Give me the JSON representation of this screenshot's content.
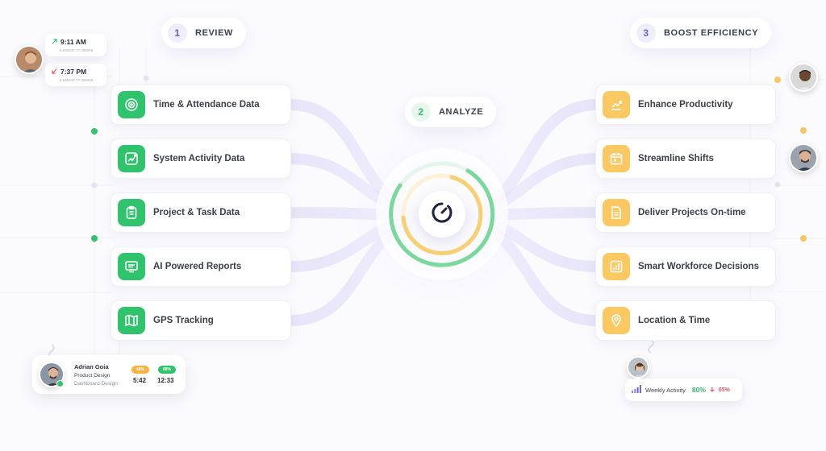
{
  "steps": [
    {
      "number": "1",
      "label": "REVIEW"
    },
    {
      "number": "2",
      "label": "ANALYZE"
    },
    {
      "number": "3",
      "label": "BOOST EFFICIENCY"
    }
  ],
  "data_sources": [
    {
      "label": "Time & Attendance Data",
      "icon": "target-icon"
    },
    {
      "label": "System Activity Data",
      "icon": "activity-chart-icon"
    },
    {
      "label": "Project & Task Data",
      "icon": "clipboard-icon"
    },
    {
      "label": "AI Powered Reports",
      "icon": "monitor-icon"
    },
    {
      "label": "GPS Tracking",
      "icon": "map-icon"
    }
  ],
  "outcomes": [
    {
      "label": "Enhance Productivity",
      "icon": "growth-chart-icon"
    },
    {
      "label": "Streamline Shifts",
      "icon": "calendar-icon"
    },
    {
      "label": "Deliver Projects On-time",
      "icon": "document-icon"
    },
    {
      "label": "Smart Workforce Decisions",
      "icon": "bar-chart-icon"
    },
    {
      "label": "Location & Time",
      "icon": "location-pin-icon"
    }
  ],
  "time_entries": [
    {
      "time": "9:11 AM",
      "direction": "in",
      "coords": "8.646447,77.385065",
      "color": "#2fc36b"
    },
    {
      "time": "7:37 PM",
      "direction": "out",
      "coords": "8.646447,77.385065",
      "color": "#e4565f"
    }
  ],
  "profile": {
    "name": "Adrian Goia",
    "role": "Product Design",
    "task": "Dashboard Design",
    "stat1_badge": "48%",
    "stat1_value": "5:42",
    "stat1_color": "#f5b342",
    "stat2_badge": "88%",
    "stat2_value": "12:33",
    "stat2_color": "#2fc36b",
    "status_color": "#2fc36b"
  },
  "weekly_activity": {
    "label": "Weekly Activity",
    "value": "80%",
    "change": "05%"
  },
  "colors": {
    "green": "#2fc36b",
    "yellow": "#fbc862",
    "purple": "#6b5ed6"
  }
}
